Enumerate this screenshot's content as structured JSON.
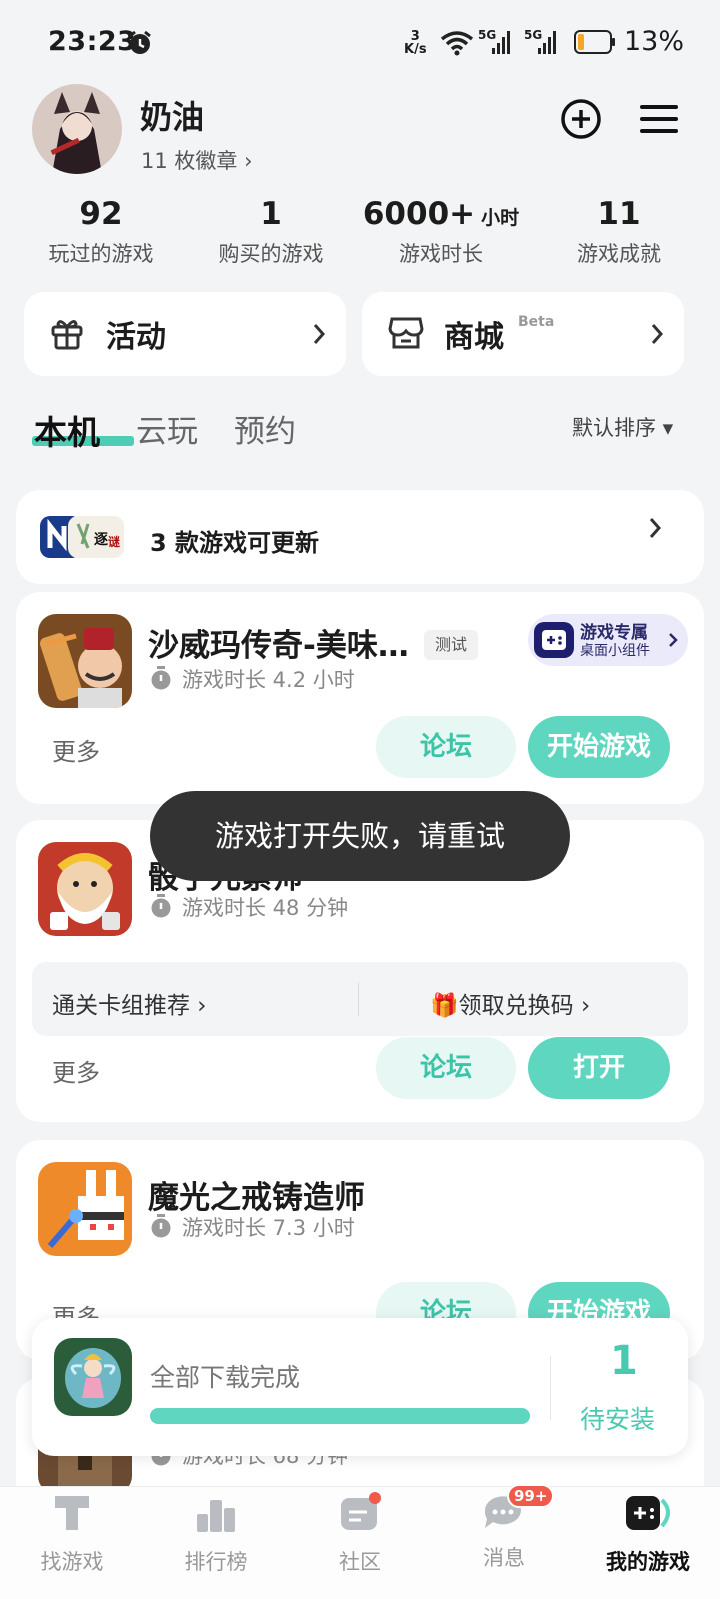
{
  "status": {
    "time": "23:23",
    "net_speed_top": "3",
    "net_speed_unit": "K/s",
    "sim1": "5G",
    "sim2": "5G",
    "battery": "13%"
  },
  "profile": {
    "name": "奶油",
    "badges": "11 枚徽章 ›"
  },
  "stats": [
    {
      "value": "92",
      "unit": "",
      "label": "玩过的游戏"
    },
    {
      "value": "1",
      "unit": "",
      "label": "购买的游戏"
    },
    {
      "value": "6000+",
      "unit": "小时",
      "label": "游戏时长"
    },
    {
      "value": "11",
      "unit": "",
      "label": "游戏成就"
    }
  ],
  "entries": {
    "activity": "活动",
    "mall": "商城",
    "mall_badge": "Beta"
  },
  "tabs": {
    "local": "本机",
    "cloud": "云玩",
    "reserve": "预约",
    "sort": "默认排序 ▾"
  },
  "update": {
    "text": "3 款游戏可更新"
  },
  "games": [
    {
      "title": "沙威玛传奇-美味…",
      "badge": "测试",
      "playtime": "游戏时长 4.2 小时",
      "more": "更多",
      "forum": "论坛",
      "action": "开始游戏",
      "widget_line1": "游戏专属",
      "widget_line2": "桌面小组件"
    },
    {
      "title": "骰子元素师",
      "playtime": "游戏时长 48 分钟",
      "more": "更多",
      "forum": "论坛",
      "action": "打开",
      "reco_left": "通关卡组推荐 ›",
      "reco_right": "🎁领取兑换码 ›"
    },
    {
      "title": "魔光之戒铸造师",
      "playtime": "游戏时长 7.3 小时",
      "more": "更多",
      "forum": "论坛",
      "action": "开始游戏"
    },
    {
      "playtime": "游戏时长 68 分钟"
    }
  ],
  "toast": "游戏打开失败，请重试",
  "download": {
    "text": "全部下载完成",
    "count": "1",
    "label": "待安装",
    "progress": 1.0
  },
  "nav": {
    "find": "找游戏",
    "rank": "排行榜",
    "community": "社区",
    "messages": "消息",
    "messages_badge": "99+",
    "mine": "我的游戏"
  },
  "colors": {
    "accent": "#5fd6bf",
    "accent_text": "#3cc3a8",
    "toast_bg": "#333333"
  }
}
